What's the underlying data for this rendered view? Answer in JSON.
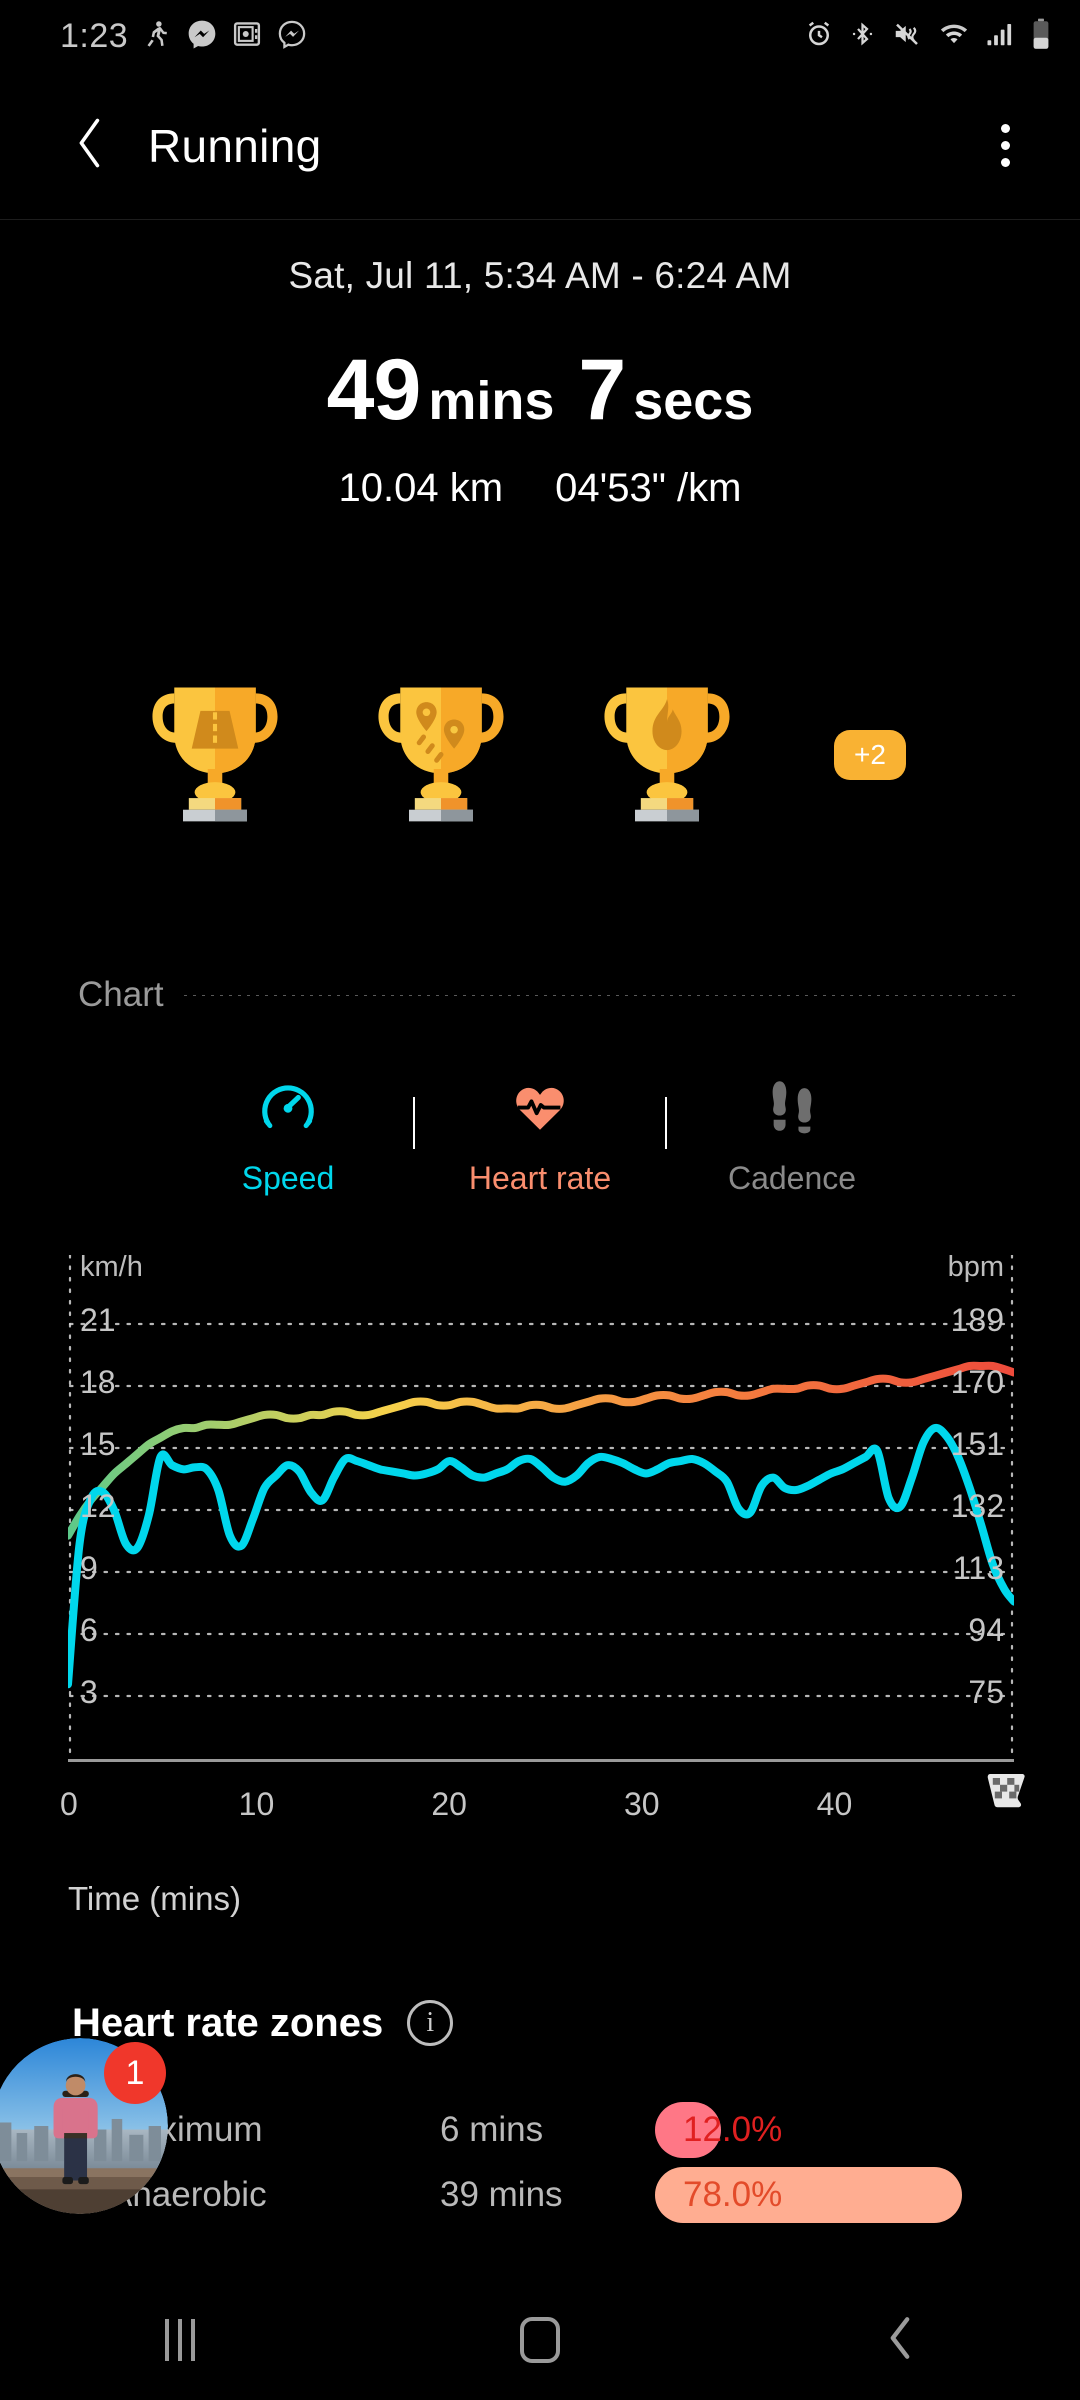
{
  "status_bar": {
    "time": "1:23",
    "notification_icons": [
      "running-person-icon",
      "messenger-filled-icon",
      "safe-vault-icon",
      "messenger-outline-icon"
    ],
    "system_icons": [
      "alarm-icon",
      "bluetooth-icon",
      "mute-vibrate-icon",
      "wifi-icon",
      "signal-icon",
      "battery-icon"
    ]
  },
  "app_bar": {
    "back_icon": "chevron-left-icon",
    "title": "Running",
    "overflow_icon": "more-vertical-icon"
  },
  "summary": {
    "date_range": "Sat, Jul 11, 5:34 AM - 6:24 AM",
    "duration_minutes": "49",
    "duration_minutes_unit": "mins",
    "duration_seconds": "7",
    "duration_seconds_unit": "secs",
    "distance": "10.04 km",
    "pace": "04'53\" /km"
  },
  "badges": {
    "trophies": [
      {
        "name": "road-trophy",
        "icon": "road-icon"
      },
      {
        "name": "route-trophy",
        "icon": "map-pin-route-icon"
      },
      {
        "name": "calories-trophy",
        "icon": "flame-icon"
      }
    ],
    "more_label": "+2",
    "more_color": "#F9B233"
  },
  "chart_section": {
    "header": "Chart",
    "tabs": [
      {
        "label": "Speed",
        "icon": "speedometer-icon",
        "color": "#00D7EC",
        "active": true
      },
      {
        "label": "Heart rate",
        "icon": "heart-pulse-icon",
        "color": "#FA8E6E",
        "active": true
      },
      {
        "label": "Cadence",
        "icon": "footsteps-icon",
        "color": "#8A8A8A",
        "active": false
      }
    ]
  },
  "chart_data": {
    "type": "line",
    "title": "Chart",
    "xlabel": "Time (mins)",
    "x_ticks": [
      "0",
      "10",
      "20",
      "30",
      "40"
    ],
    "xlim": [
      0,
      49.1
    ],
    "end_marker_icon": "checkered-flag-icon",
    "grid": true,
    "legend_position": "top",
    "axes": [
      {
        "side": "left",
        "unit": "km/h",
        "ticks": [
          21,
          18,
          15,
          12,
          9,
          6,
          3
        ],
        "ylim": [
          1.5,
          22.5
        ]
      },
      {
        "side": "right",
        "unit": "bpm",
        "ticks": [
          189,
          170,
          151,
          132,
          113,
          94,
          75
        ],
        "ylim": [
          65.5,
          198.5
        ]
      }
    ],
    "series": [
      {
        "name": "Speed",
        "unit": "km/h",
        "axis": "left",
        "color": "#00D7EC",
        "x": [
          0.0,
          0.6,
          1.2,
          1.8,
          2.4,
          3.0,
          3.6,
          4.2,
          4.8,
          5.4,
          6.0,
          6.6,
          7.2,
          7.8,
          8.4,
          9.0,
          9.6,
          10.2,
          10.8,
          11.4,
          12.0,
          12.6,
          13.2,
          13.8,
          14.4,
          15.0,
          15.6,
          16.2,
          16.8,
          17.4,
          18.0,
          18.6,
          19.2,
          19.8,
          20.4,
          21.0,
          21.6,
          22.2,
          22.8,
          23.4,
          24.0,
          24.6,
          25.2,
          25.8,
          26.4,
          27.0,
          27.6,
          28.2,
          28.8,
          29.4,
          30.0,
          30.6,
          31.2,
          31.8,
          32.4,
          33.0,
          33.6,
          34.2,
          34.8,
          35.4,
          36.0,
          36.6,
          37.2,
          37.8,
          38.4,
          39.0,
          39.6,
          40.2,
          40.8,
          41.4,
          42.0,
          42.6,
          43.2,
          43.8,
          44.4,
          45.0,
          45.6,
          46.2,
          46.8,
          47.4,
          48.0,
          48.6,
          49.1
        ],
        "values": [
          2.6,
          9.4,
          11.6,
          11.9,
          11.0,
          9.4,
          9.2,
          10.8,
          13.6,
          13.2,
          13.0,
          13.1,
          13.0,
          12.0,
          9.8,
          9.3,
          10.6,
          12.1,
          12.7,
          13.2,
          12.9,
          11.9,
          11.5,
          12.6,
          13.5,
          13.4,
          13.2,
          13.0,
          12.9,
          12.8,
          12.7,
          12.8,
          13.0,
          13.4,
          13.1,
          12.7,
          12.6,
          12.8,
          13.0,
          13.4,
          13.5,
          13.1,
          12.6,
          12.4,
          12.7,
          13.3,
          13.6,
          13.5,
          13.3,
          13.0,
          12.8,
          13.0,
          13.3,
          13.4,
          13.5,
          13.3,
          12.9,
          12.4,
          11.1,
          10.9,
          12.2,
          12.6,
          12.1,
          12.0,
          12.2,
          12.5,
          12.8,
          13.0,
          13.3,
          13.6,
          13.9,
          11.6,
          11.2,
          12.6,
          14.3,
          15.0,
          14.6,
          13.6,
          12.1,
          10.3,
          8.4,
          7.2,
          6.6
        ]
      },
      {
        "name": "Heart rate",
        "unit": "bpm",
        "axis": "right",
        "color_gradient": [
          "#5CC98A",
          "#F6D24B",
          "#F5833F",
          "#EE4B3C"
        ],
        "x": [
          0.0,
          0.6,
          1.2,
          1.8,
          2.4,
          3.0,
          3.6,
          4.2,
          4.8,
          5.4,
          6.0,
          6.6,
          7.2,
          7.8,
          8.4,
          9.0,
          9.6,
          10.2,
          10.8,
          11.4,
          12.0,
          12.6,
          13.2,
          13.8,
          14.4,
          15.0,
          15.6,
          16.2,
          16.8,
          17.4,
          18.0,
          18.6,
          19.2,
          19.8,
          20.4,
          21.0,
          21.6,
          22.2,
          22.8,
          23.4,
          24.0,
          24.6,
          25.2,
          25.8,
          26.4,
          27.0,
          27.6,
          28.2,
          28.8,
          29.4,
          30.0,
          30.6,
          31.2,
          31.8,
          32.4,
          33.0,
          33.6,
          34.2,
          34.8,
          35.4,
          36.0,
          36.6,
          37.2,
          37.8,
          38.4,
          39.0,
          39.6,
          40.2,
          40.8,
          41.4,
          42.0,
          42.6,
          43.2,
          43.8,
          44.4,
          45.0,
          45.6,
          46.2,
          46.8,
          47.4,
          48.0,
          48.6,
          49.1
        ],
        "values": [
          118,
          124,
          129,
          133,
          137,
          140,
          143,
          146,
          148,
          150,
          151,
          151,
          152,
          152,
          152,
          153,
          154,
          155,
          155,
          154,
          154,
          155,
          155,
          156,
          156,
          155,
          155,
          156,
          157,
          158,
          159,
          159,
          158,
          158,
          159,
          159,
          158,
          157,
          157,
          157,
          158,
          158,
          157,
          157,
          158,
          159,
          160,
          160,
          159,
          159,
          160,
          161,
          161,
          160,
          160,
          161,
          162,
          162,
          161,
          161,
          162,
          163,
          163,
          163,
          164,
          164,
          163,
          163,
          164,
          165,
          166,
          166,
          165,
          165,
          166,
          167,
          168,
          169,
          170,
          170,
          170,
          169,
          168
        ]
      }
    ]
  },
  "heart_rate_zones": {
    "title": "Heart rate zones",
    "info_icon": "info-circle-icon",
    "rows": [
      {
        "name": "5. Maximum",
        "mins": "6 mins",
        "percent": "12.0%",
        "value": 12.0,
        "bar_color": "#FF7786",
        "text_color": "#E02020"
      },
      {
        "name": "4. Anaerobic",
        "mins": "39 mins",
        "percent": "78.0%",
        "value": 78.0,
        "bar_color": "#FFAD91",
        "text_color": "#E34B2A"
      }
    ]
  },
  "chat_bubble": {
    "badge_count": "1",
    "avatar_icon": "person-photo-avatar",
    "badge_color": "#F0372B"
  },
  "nav_bar": {
    "recents_icon": "recents-icon",
    "home_icon": "home-icon",
    "back_icon": "back-chevron-icon"
  }
}
